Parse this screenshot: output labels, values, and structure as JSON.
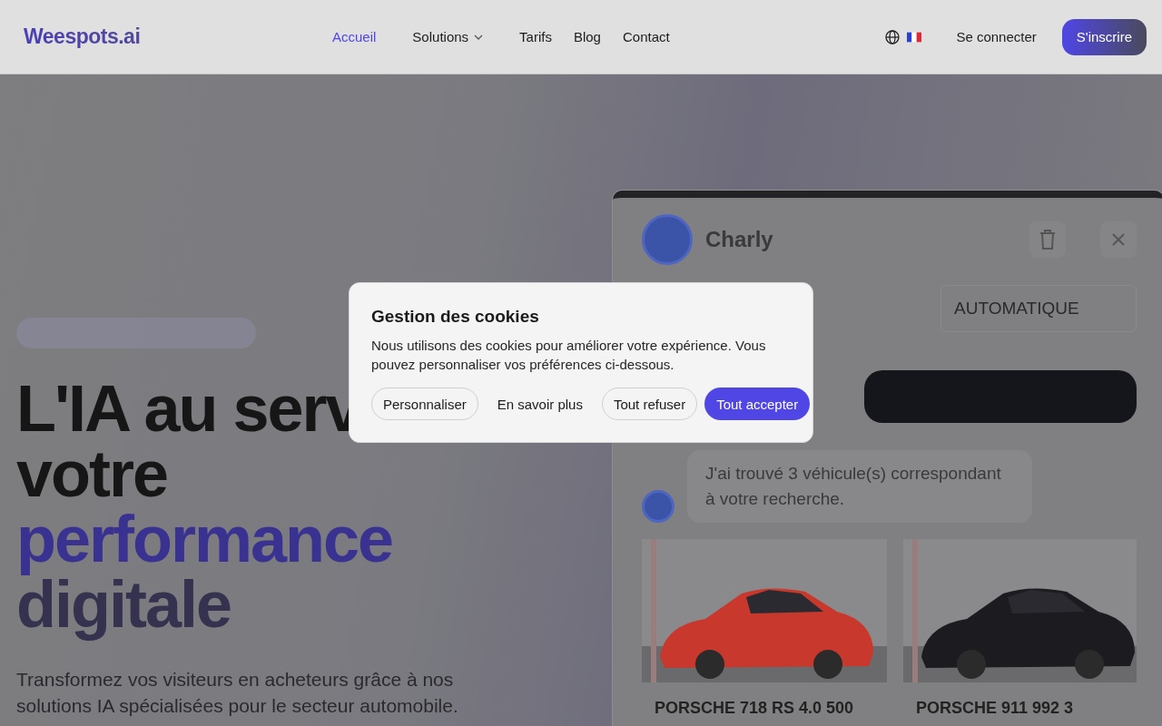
{
  "nav": {
    "logo": "Weespots.ai",
    "links": [
      {
        "label": "Accueil",
        "selected": true,
        "kind": "link"
      },
      {
        "label": "Solutions",
        "selected": false,
        "kind": "dropdown"
      },
      {
        "label": "Tarifs",
        "selected": false,
        "kind": "link"
      },
      {
        "label": "Blog",
        "selected": false,
        "kind": "link"
      },
      {
        "label": "Contact",
        "selected": false,
        "kind": "link"
      }
    ],
    "login": "Se connecter",
    "signup": "S'inscrire"
  },
  "hero": {
    "title_lines": [
      {
        "text": "L'IA au serv",
        "kind": "dark"
      },
      {
        "text": "votre",
        "kind": "dark"
      },
      {
        "text": "performance",
        "kind": "accent"
      },
      {
        "text": "digitale",
        "kind": "muted"
      }
    ],
    "subtitle": "Transformez vos visiteurs en acheteurs grâce à nos solutions IA spécialisées pour le secteur automobile."
  },
  "chat": {
    "bot_name": "Charly",
    "filter": "AUTOMATIQUE",
    "bot_message": "J'ai trouvé 3 véhicule(s) correspondant à votre recherche.",
    "cars": [
      {
        "title": "PORSCHE 718 RS 4.0 500",
        "kind": "picture"
      },
      {
        "title": "PORSCHE 911 992 3",
        "kind": "picture"
      }
    ]
  },
  "cookie_dialog": {
    "title": "Gestion des cookies",
    "text": "Nous utilisons des cookies pour améliorer votre expérience. Vous pouvez personnaliser vos préférences ci-dessous.",
    "buttons": [
      {
        "label": "Personnaliser",
        "kind": "outline"
      },
      {
        "label": "En savoir plus",
        "kind": "text"
      },
      {
        "label": "Tout refuser",
        "kind": "outline"
      },
      {
        "label": "Tout accepter",
        "kind": "primary"
      }
    ]
  }
}
